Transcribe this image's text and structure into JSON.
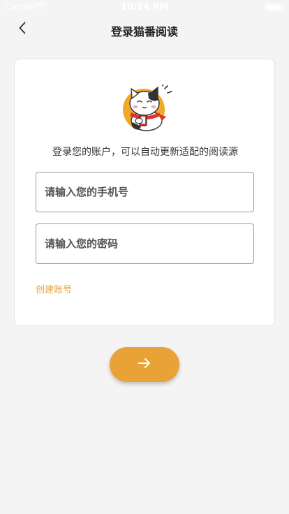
{
  "status_bar": {
    "carrier": "Carrier",
    "time": "10:24 PM"
  },
  "nav": {
    "back_icon": "chevron-left-icon",
    "title": "登录猫番阅读"
  },
  "card": {
    "mascot": "cat-mascot-logo",
    "subtitle": "登录您的账户，可以自动更新适配的阅读源",
    "phone_placeholder": "请输入您的手机号",
    "password_placeholder": "请输入您的密码",
    "create_account_label": "创建账号"
  },
  "submit": {
    "icon": "arrow-right-icon"
  },
  "colors": {
    "accent": "#e9a236",
    "link": "#e8a03b",
    "background": "#f4f4f4",
    "card": "#ffffff"
  }
}
